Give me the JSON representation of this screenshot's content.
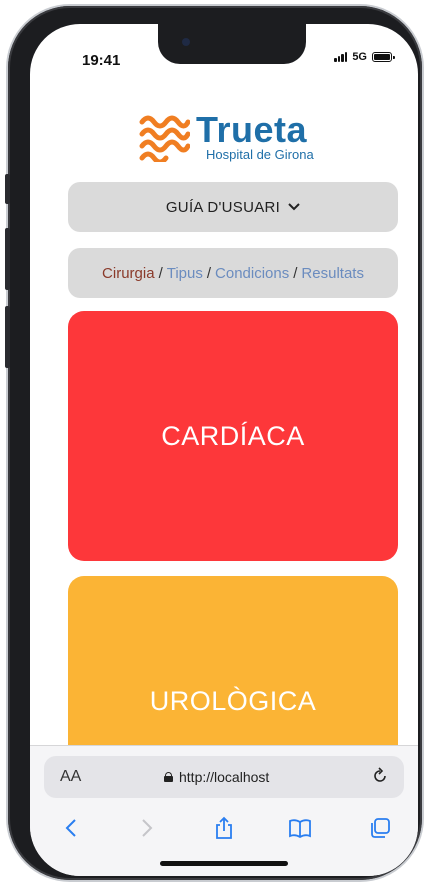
{
  "status_bar": {
    "time": "19:41",
    "network": "5G"
  },
  "logo": {
    "name": "Trueta",
    "subtitle": "Hospital de Girona"
  },
  "guide": {
    "label": "GUÍA D'USUARI"
  },
  "breadcrumb": {
    "items": [
      "Cirurgia",
      "Tipus",
      "Condicions",
      "Resultats"
    ],
    "separator": "/"
  },
  "cards": [
    {
      "label": "CARDÍACA",
      "color": "#fd373a"
    },
    {
      "label": "UROLÒGICA",
      "color": "#fbb435"
    }
  ],
  "browser": {
    "text_size_label": "AA",
    "url": "http://localhost"
  },
  "colors": {
    "brand_blue": "#1f6fa8",
    "brand_orange": "#f07e22",
    "link": "#6b8cbf",
    "active": "#8a3a2a"
  }
}
